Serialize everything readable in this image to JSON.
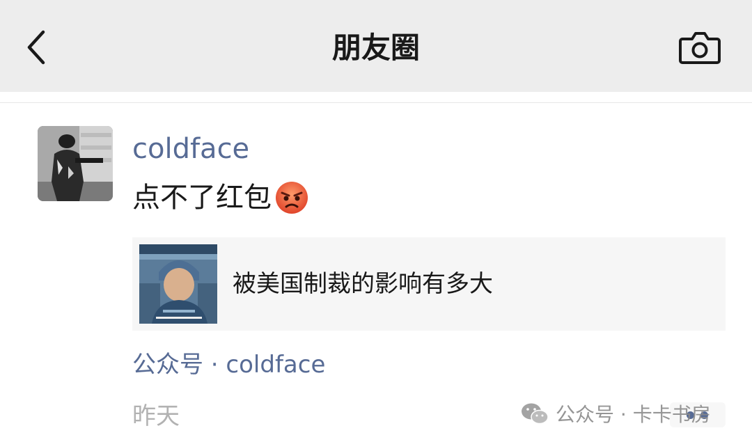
{
  "header": {
    "title": "朋友圈",
    "back_icon": "chevron-left-icon",
    "camera_icon": "camera-icon"
  },
  "post": {
    "username": "coldface",
    "text": "点不了红包",
    "emoji_icon": "angry-face-emoji",
    "link": {
      "title": "被美国制裁的影响有多大"
    },
    "source": "公众号 · coldface",
    "time": "昨天"
  },
  "watermark": {
    "text": "公众号 · 卡卡书房",
    "icon": "wechat-icon"
  },
  "colors": {
    "header_bg": "#ededed",
    "link_blue": "#576b95",
    "text": "#191919",
    "muted": "#b2b2b2"
  }
}
